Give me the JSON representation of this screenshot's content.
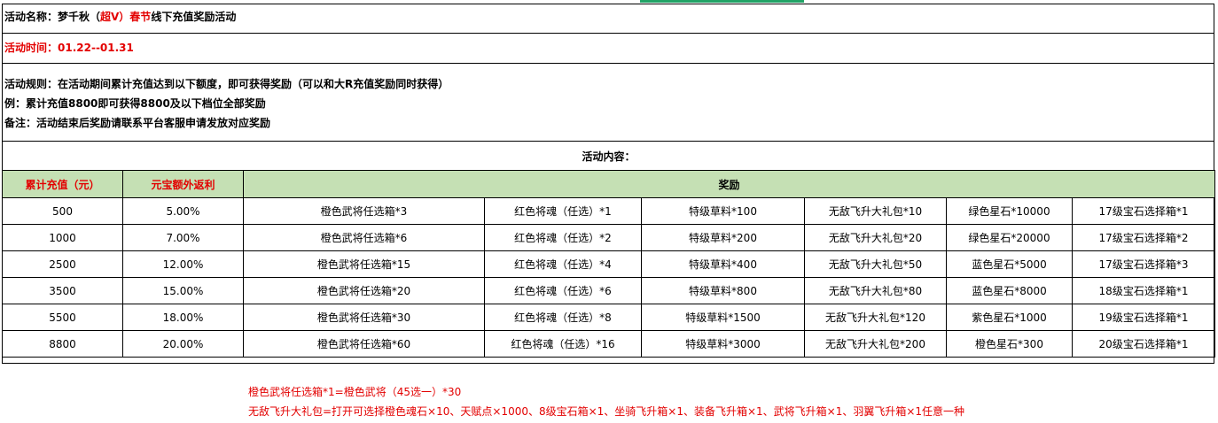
{
  "header": {
    "name_prefix": "活动名称：梦千秋（",
    "name_highlight": "超V）春节",
    "name_suffix": "线下充值奖励活动",
    "time": "活动时间：01.22--01.31",
    "rules": [
      "活动规则：在活动期间累计充值达到以下额度，即可获得奖励（可以和大R充值奖励同时获得）",
      "例：累计充值8800即可获得8800及以下档位全部奖励",
      "备注：活动结束后奖励请联系平台客服申请发放对应奖励"
    ],
    "content_label": "活动内容："
  },
  "table": {
    "headers": [
      "累计充值（元）",
      "元宝额外返利",
      "奖励"
    ],
    "rows": [
      [
        "500",
        "5.00%",
        "橙色武将任选箱*3",
        "红色将魂（任选）*1",
        "特级草料*100",
        "无敌飞升大礼包*10",
        "绿色星石*10000",
        "17级宝石选择箱*1"
      ],
      [
        "1000",
        "7.00%",
        "橙色武将任选箱*6",
        "红色将魂（任选）*2",
        "特级草料*200",
        "无敌飞升大礼包*20",
        "绿色星石*20000",
        "17级宝石选择箱*2"
      ],
      [
        "2500",
        "12.00%",
        "橙色武将任选箱*15",
        "红色将魂（任选）*4",
        "特级草料*400",
        "无敌飞升大礼包*50",
        "蓝色星石*5000",
        "17级宝石选择箱*3"
      ],
      [
        "3500",
        "15.00%",
        "橙色武将任选箱*20",
        "红色将魂（任选）*6",
        "特级草料*800",
        "无敌飞升大礼包*80",
        "蓝色星石*8000",
        "18级宝石选择箱*1"
      ],
      [
        "5500",
        "18.00%",
        "橙色武将任选箱*30",
        "红色将魂（任选）*8",
        "特级草料*1500",
        "无敌飞升大礼包*120",
        "紫色星石*1000",
        "19级宝石选择箱*1"
      ],
      [
        "8800",
        "20.00%",
        "橙色武将任选箱*60",
        "红色将魂（任选）*16",
        "特级草料*3000",
        "无敌飞升大礼包*200",
        "橙色星石*300",
        "20级宝石选择箱*1"
      ]
    ]
  },
  "notes": [
    "橙色武将任选箱*1=橙色武将（45选一）*30",
    "无敌飞升大礼包=打开可选择橙色魂石×10、天赋点×1000、8级宝石箱×1、坐骑飞升箱×1、装备飞升箱×1、武将飞升箱×1、羽翼飞升箱×1任意一种"
  ],
  "colors": {
    "accent_red": "#e30000",
    "header_green": "#c5e0b4",
    "excel_green": "#21a366"
  }
}
